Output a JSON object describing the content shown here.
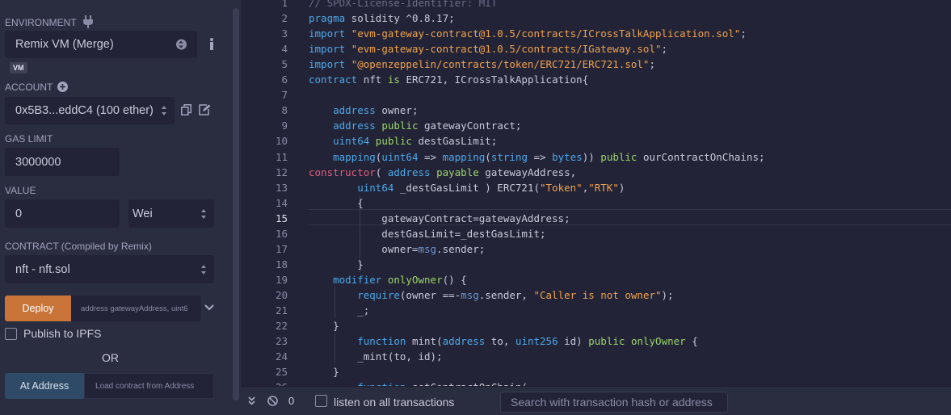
{
  "run_panel": {
    "environment_label": "ENVIRONMENT",
    "environment_value": "Remix VM (Merge)",
    "vm_badge": "VM",
    "account_label": "ACCOUNT",
    "account_value": "0x5B3...eddC4 (100 ether)",
    "gas_limit_label": "GAS LIMIT",
    "gas_limit_value": "3000000",
    "value_label": "VALUE",
    "value_amount": "0",
    "value_unit": "Wei",
    "contract_label": "CONTRACT",
    "contract_sub": "(Compiled by Remix)",
    "contract_value": "nft - nft.sol",
    "deploy_label": "Deploy",
    "deploy_args_placeholder": "address gatewayAddress, uint6",
    "publish_label": "Publish to IPFS",
    "or_label": "OR",
    "at_address_label": "At Address",
    "at_address_placeholder": "Load contract from Address"
  },
  "editor": {
    "current_line": 15,
    "lines": [
      {
        "n": "1",
        "text": "// SPDX-License-Identifier: MIT"
      },
      {
        "n": "2",
        "text": "pragma solidity ^0.8.17;"
      },
      {
        "n": "3",
        "text": "import \"evm-gateway-contract@1.0.5/contracts/ICrossTalkApplication.sol\";"
      },
      {
        "n": "4",
        "text": "import \"evm-gateway-contract@1.0.5/contracts/IGateway.sol\";"
      },
      {
        "n": "5",
        "text": "import \"@openzeppelin/contracts/token/ERC721/ERC721.sol\";"
      },
      {
        "n": "6",
        "text": "contract nft is ERC721, ICrossTalkApplication{"
      },
      {
        "n": "7",
        "text": ""
      },
      {
        "n": "8",
        "text": "    address owner;"
      },
      {
        "n": "9",
        "text": "    address public gatewayContract;"
      },
      {
        "n": "10",
        "text": "    uint64 public destGasLimit;"
      },
      {
        "n": "11",
        "text": "    mapping(uint64 => mapping(string => bytes)) public ourContractOnChains;"
      },
      {
        "n": "12",
        "text": "constructor( address payable gatewayAddress,"
      },
      {
        "n": "13",
        "text": "        uint64 _destGasLimit ) ERC721(\"Token\",\"RTK\")"
      },
      {
        "n": "14",
        "text": "        {"
      },
      {
        "n": "15",
        "text": "            gatewayContract=gatewayAddress;"
      },
      {
        "n": "16",
        "text": "            destGasLimit=_destGasLimit;"
      },
      {
        "n": "17",
        "text": "            owner=msg.sender;"
      },
      {
        "n": "18",
        "text": "        }"
      },
      {
        "n": "19",
        "text": "    modifier onlyOwner() {"
      },
      {
        "n": "20",
        "text": "        require(owner ==-msg.sender, \"Caller is not owner\");"
      },
      {
        "n": "21",
        "text": "        _;"
      },
      {
        "n": "22",
        "text": "    }"
      },
      {
        "n": "23",
        "text": "        function mint(address to, uint256 id) public onlyOwner {"
      },
      {
        "n": "24",
        "text": "        _mint(to, id);"
      },
      {
        "n": "25",
        "text": "    }"
      },
      {
        "n": "26",
        "text": "        function setContractOnChain("
      }
    ]
  },
  "terminal": {
    "pending_count": "0",
    "listen_label": "listen on all transactions",
    "search_placeholder": "Search with transaction hash or address"
  },
  "colors": {
    "deploy": "#c97539",
    "at_address": "#2f4a66",
    "keyword": "#4da8ea",
    "string": "#f0a34e",
    "constructor": "#e05d7c"
  }
}
